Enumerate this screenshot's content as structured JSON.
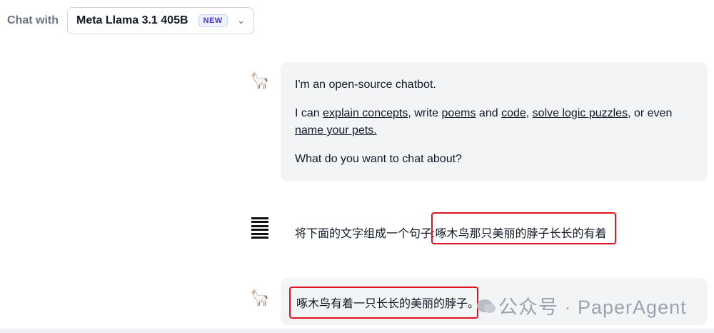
{
  "header": {
    "chat_with_label": "Chat with",
    "model_name": "Meta Llama 3.1 405B",
    "badge": "NEW",
    "dropdown_icon": "chevron-down-icon"
  },
  "messages": {
    "bot_intro": {
      "avatar": "🦙",
      "line1": "I'm an open-source chatbot.",
      "line2_prefix": "I can ",
      "link_explain": "explain concepts",
      "sep1": ", write ",
      "link_poems": "poems",
      "sep2": " and ",
      "link_code": "code",
      "sep3": ", ",
      "link_logic": "solve logic puzzles",
      "sep4": ", or even ",
      "link_pets": "name your pets.",
      "line3": "What do you want to chat about?"
    },
    "user": {
      "prefix": "将下面的文字组成一个句子:",
      "highlight": "啄木鸟那只美丽的脖子长长的有着"
    },
    "bot_reply": {
      "avatar": "🦙",
      "text": "啄木鸟有着一只长长的美丽的脖子。"
    }
  },
  "watermark": {
    "text": "公众号 · PaperAgent",
    "icon": "wechat-icon"
  },
  "colors": {
    "highlight_border": "#e0141f",
    "bubble_bg": "#f3f4f6",
    "badge_text": "#4338ca"
  }
}
